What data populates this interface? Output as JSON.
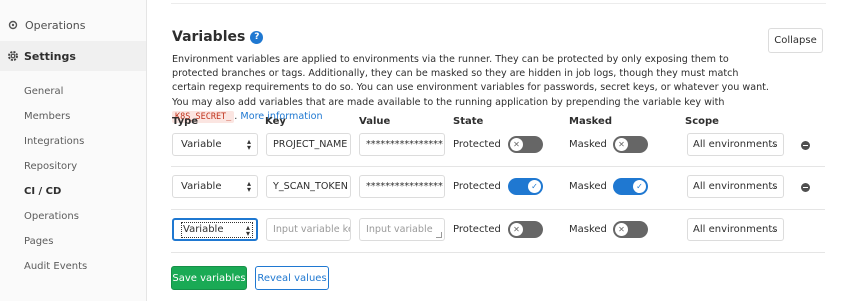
{
  "sidebar": {
    "operations_top": "Operations",
    "settings": "Settings",
    "items": [
      {
        "label": "General"
      },
      {
        "label": "Members"
      },
      {
        "label": "Integrations"
      },
      {
        "label": "Repository"
      },
      {
        "label": "CI / CD",
        "active": true
      },
      {
        "label": "Operations"
      },
      {
        "label": "Pages"
      },
      {
        "label": "Audit Events"
      }
    ]
  },
  "section": {
    "title": "Variables",
    "collapse_label": "Collapse",
    "description_1": "Environment variables are applied to environments via the runner. They can be protected by only exposing them to protected branches or tags. Additionally, they can be masked so they are hidden in job logs, though they must match certain regexp requirements to do so. You can use environment variables for passwords, secret keys, or whatever you want. You may also add variables that are made available to the running application by prepending the variable key with ",
    "code": "K8S_SECRET_",
    "description_2": ".",
    "more_info": "More information"
  },
  "headers": {
    "type": "Type",
    "key": "Key",
    "value": "Value",
    "state": "State",
    "masked": "Masked",
    "scope": "Scope"
  },
  "rows": [
    {
      "type": "Variable",
      "key": "PROJECT_NAME",
      "value": "****************",
      "state_label": "Protected",
      "protected": false,
      "masked_label": "Masked",
      "masked": false,
      "scope": "All environments"
    },
    {
      "type": "Variable",
      "key": "Y_SCAN_TOKEN",
      "value": "****************",
      "state_label": "Protected",
      "protected": true,
      "masked_label": "Masked",
      "masked": true,
      "scope": "All environments"
    },
    {
      "type": "Variable",
      "key_placeholder": "Input variable ke",
      "value_placeholder": "Input variable",
      "state_label": "Protected",
      "protected": false,
      "masked_label": "Masked",
      "masked": false,
      "scope": "All environments"
    }
  ],
  "buttons": {
    "save": "Save variables",
    "reveal": "Reveal values"
  },
  "colors": {
    "accent": "#1f78d1",
    "success": "#1aaa55",
    "toggle_off": "#666666"
  },
  "icons": {
    "help": "?",
    "toggle_off": "✕",
    "toggle_on": "✓",
    "select_arrows": "⬍",
    "chevron": "⌄"
  }
}
